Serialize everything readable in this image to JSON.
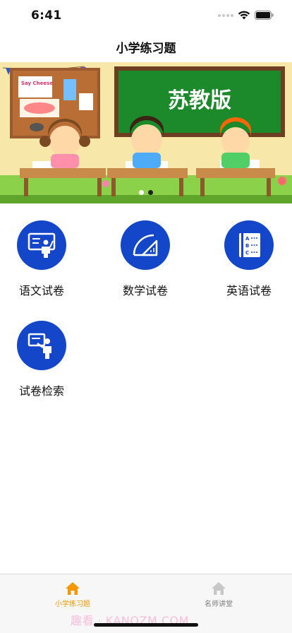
{
  "status_bar": {
    "time": "6:41"
  },
  "nav": {
    "title": "小学练习题"
  },
  "banner": {
    "board_text": "苏教版",
    "poster_text": "Say Cheese",
    "page_count": 2,
    "active_page": 2
  },
  "tiles": [
    {
      "label": "语文试卷",
      "icon": "teacher-board-icon"
    },
    {
      "label": "数学试卷",
      "icon": "protractor-triangle-icon"
    },
    {
      "label": "英语试卷",
      "icon": "abc-book-icon"
    },
    {
      "label": "试卷检索",
      "icon": "teacher-pointing-icon"
    }
  ],
  "tabbar": {
    "items": [
      {
        "label": "小学练习题",
        "icon": "home-icon",
        "active": true
      },
      {
        "label": "名师讲堂",
        "icon": "home-icon",
        "active": false
      }
    ],
    "watermark": "趣看 · KANQZM.COM"
  },
  "colors": {
    "accent": "#f39800",
    "icon_blue": "#1346c9",
    "inactive": "#7a7a7a",
    "board_green": "#1c8a2a"
  }
}
